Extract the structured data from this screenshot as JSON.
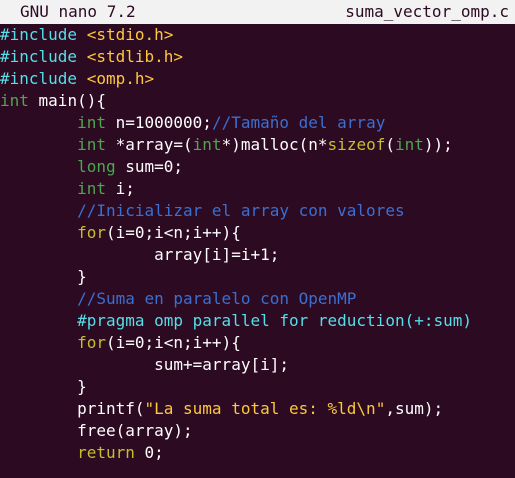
{
  "titlebar": {
    "app_name": "GNU nano 7.2",
    "file_name": "suma_vector_omp.c"
  },
  "colors": {
    "background": "#2c0a22",
    "titlebar_bg": "#f2f2f2",
    "titlebar_fg": "#2c0a22",
    "plain": "#ffffff",
    "preprocessor": "#55dfe8",
    "include_file": "#fdc83b",
    "type": "#4ea650",
    "comment": "#3b6fd0",
    "control": "#c2c02c",
    "pragma": "#55dfe8",
    "string": "#fdc83b"
  },
  "code_lines": [
    [
      {
        "t": "#include ",
        "c": "preprocessor"
      },
      {
        "t": "<stdio.h>",
        "c": "include_file"
      }
    ],
    [
      {
        "t": "#include ",
        "c": "preprocessor"
      },
      {
        "t": "<stdlib.h>",
        "c": "include_file"
      }
    ],
    [
      {
        "t": "#include ",
        "c": "preprocessor"
      },
      {
        "t": "<omp.h>",
        "c": "include_file"
      }
    ],
    [
      {
        "t": "int",
        "c": "type"
      },
      {
        "t": " main(){",
        "c": "plain"
      }
    ],
    [
      {
        "t": "        ",
        "c": "plain"
      },
      {
        "t": "int",
        "c": "type"
      },
      {
        "t": " n=1000000;",
        "c": "plain"
      },
      {
        "t": "//Tamaño del array",
        "c": "comment"
      }
    ],
    [
      {
        "t": "        ",
        "c": "plain"
      },
      {
        "t": "int",
        "c": "type"
      },
      {
        "t": " *array=(",
        "c": "plain"
      },
      {
        "t": "int",
        "c": "type"
      },
      {
        "t": "*)malloc(n*",
        "c": "plain"
      },
      {
        "t": "sizeof",
        "c": "control"
      },
      {
        "t": "(",
        "c": "plain"
      },
      {
        "t": "int",
        "c": "type"
      },
      {
        "t": "));",
        "c": "plain"
      }
    ],
    [
      {
        "t": "        ",
        "c": "plain"
      },
      {
        "t": "long",
        "c": "type"
      },
      {
        "t": " sum=0;",
        "c": "plain"
      }
    ],
    [
      {
        "t": "        ",
        "c": "plain"
      },
      {
        "t": "int",
        "c": "type"
      },
      {
        "t": " i;",
        "c": "plain"
      }
    ],
    [
      {
        "t": "        ",
        "c": "plain"
      },
      {
        "t": "//Inicializar el array con valores",
        "c": "comment"
      }
    ],
    [
      {
        "t": "        ",
        "c": "plain"
      },
      {
        "t": "for",
        "c": "control"
      },
      {
        "t": "(i=0;i<n;i++){",
        "c": "plain"
      }
    ],
    [
      {
        "t": "                array[i]=i+1;",
        "c": "plain"
      }
    ],
    [
      {
        "t": "        }",
        "c": "plain"
      }
    ],
    [
      {
        "t": "        ",
        "c": "plain"
      },
      {
        "t": "//Suma en paralelo con OpenMP",
        "c": "comment"
      }
    ],
    [
      {
        "t": "        ",
        "c": "plain"
      },
      {
        "t": "#pragma omp parallel for reduction(+:sum)",
        "c": "pragma"
      }
    ],
    [
      {
        "t": "        ",
        "c": "plain"
      },
      {
        "t": "for",
        "c": "control"
      },
      {
        "t": "(i=0;i<n;i++){",
        "c": "plain"
      }
    ],
    [
      {
        "t": "                sum+=array[i];",
        "c": "plain"
      }
    ],
    [
      {
        "t": "        }",
        "c": "plain"
      }
    ],
    [
      {
        "t": "        printf(",
        "c": "plain"
      },
      {
        "t": "\"La suma total es: %ld\\n\"",
        "c": "string"
      },
      {
        "t": ",sum);",
        "c": "plain"
      }
    ],
    [
      {
        "t": "        free(array);",
        "c": "plain"
      }
    ],
    [
      {
        "t": "        ",
        "c": "plain"
      },
      {
        "t": "return",
        "c": "control"
      },
      {
        "t": " 0;",
        "c": "plain"
      }
    ]
  ]
}
